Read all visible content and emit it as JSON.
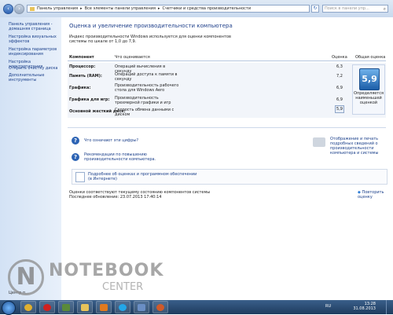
{
  "breadcrumb": [
    "Панель управления",
    "Все элементы панели управления",
    "Счетчики и средства производительности"
  ],
  "search_placeholder": "Поиск в панели упр...",
  "sidebar": {
    "items": [
      {
        "label": "Панель управления - домашняя страница"
      },
      {
        "label": "Настройка визуальных эффектов"
      },
      {
        "label": "Настройка параметров индексирования"
      },
      {
        "label": "Настройка электропитания"
      },
      {
        "label": "Открыть очистку диска"
      },
      {
        "label": "Дополнительные инструменты"
      }
    ],
    "bottom": "Центр п..."
  },
  "main": {
    "title": "Оценка и увеличение производительности компьютера",
    "description": "Индекс производительности Windows используется для оценки компонентов системы по шкале от 1,0 до 7,9.",
    "headers": {
      "component": "Компонент",
      "what": "Что оценивается",
      "score": "Оценка",
      "overall": "Общая оценка"
    },
    "rows": [
      {
        "component": "Процессор:",
        "what": "Операций вычисления в секунду",
        "score": "6,3"
      },
      {
        "component": "Память (RAM):",
        "what": "Операций доступа к памяти в секунду",
        "score": "7,2"
      },
      {
        "component": "Графика:",
        "what": "Производительность рабочего стола для Windows Aero",
        "score": "6,9"
      },
      {
        "component": "Графика для игр:",
        "what": "Производительность трехмерной графики и игр",
        "score": "6,9"
      },
      {
        "component": "Основной жесткий диск:",
        "what": "Скорость обмена данными с диском",
        "score": "5,9"
      }
    ],
    "overall": {
      "value": "5,9",
      "label": "Определяется наименьшей оценкой"
    },
    "links": {
      "what_mean": "Что означают эти цифры?",
      "recommendations": "Рекомендации по повышению производительности компьютера.",
      "print": "Отображение и печать подробных сведений о производительности компьютера и системы",
      "more_info": "Подробнее об оценках и программном обеспечении (в Интернете)",
      "rerun": "Повторить оценку"
    },
    "status": "Оценки соответствуют текущему состоянию компонентов системы",
    "last_update": "Последнее обновление: 23.07.2013 17:40:14"
  },
  "watermark": {
    "line1": "NOTEBOOK",
    "line2": "CENTER"
  },
  "taskbar": {
    "lang": "RU",
    "time": "13:28",
    "date": "31.08.2013"
  },
  "colors": {
    "accent": "#1a3f8a",
    "badge": "#1c5ea8",
    "taskbar": "#1e3c5e"
  }
}
